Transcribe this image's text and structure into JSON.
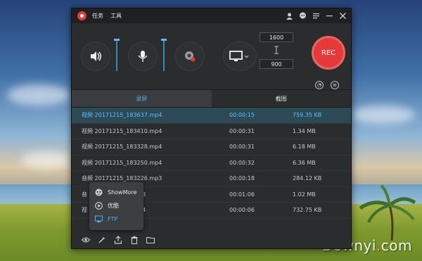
{
  "window": {
    "menu": [
      "任务",
      "工具"
    ],
    "titlebar_icons": [
      "account-icon",
      "chat-icon",
      "menu-icon",
      "minimize-icon",
      "close-icon"
    ]
  },
  "toolbar": {
    "resolution_width": "1600",
    "resolution_height": "900",
    "rec_label": "REC"
  },
  "tabs": [
    {
      "label": "录屏",
      "active": true
    },
    {
      "label": "截图",
      "active": false
    }
  ],
  "files": [
    {
      "name": "视频 20171215_183637.mp4",
      "duration": "00:00:15",
      "size": "759.35 KB",
      "selected": true
    },
    {
      "name": "视频 20171215_183410.mp4",
      "duration": "00:00:31",
      "size": "1.34 MB",
      "selected": false
    },
    {
      "name": "视频 20171215_183328.mp4",
      "duration": "00:00:31",
      "size": "6.18 MB",
      "selected": false
    },
    {
      "name": "视频 20171215_183250.mp4",
      "duration": "00:00:32",
      "size": "6.36 MB",
      "selected": false
    },
    {
      "name": "音频 20171215_183226.mp3",
      "duration": "00:00:18",
      "size": "284.12 KB",
      "selected": false
    },
    {
      "name": "音",
      "name_tail": "p3",
      "duration": "00:01:06",
      "size": "1.02 MB",
      "selected": false
    },
    {
      "name": "视",
      "name_tail": "p4",
      "duration": "00:00:06",
      "size": "732.75 KB",
      "selected": false
    }
  ],
  "share_menu": [
    {
      "label": "ShowMore",
      "icon": "showmore-icon",
      "active": false
    },
    {
      "label": "优酷",
      "icon": "youku-icon",
      "active": false
    },
    {
      "label": "FTP",
      "icon": "ftp-icon",
      "active": true
    }
  ],
  "watermark": {
    "part1": "Downyi",
    "dot": ".",
    "part2": "com"
  },
  "colors": {
    "accent": "#49b4f0",
    "rec": "#e63a3a",
    "selected_row": "#2d4a57"
  }
}
